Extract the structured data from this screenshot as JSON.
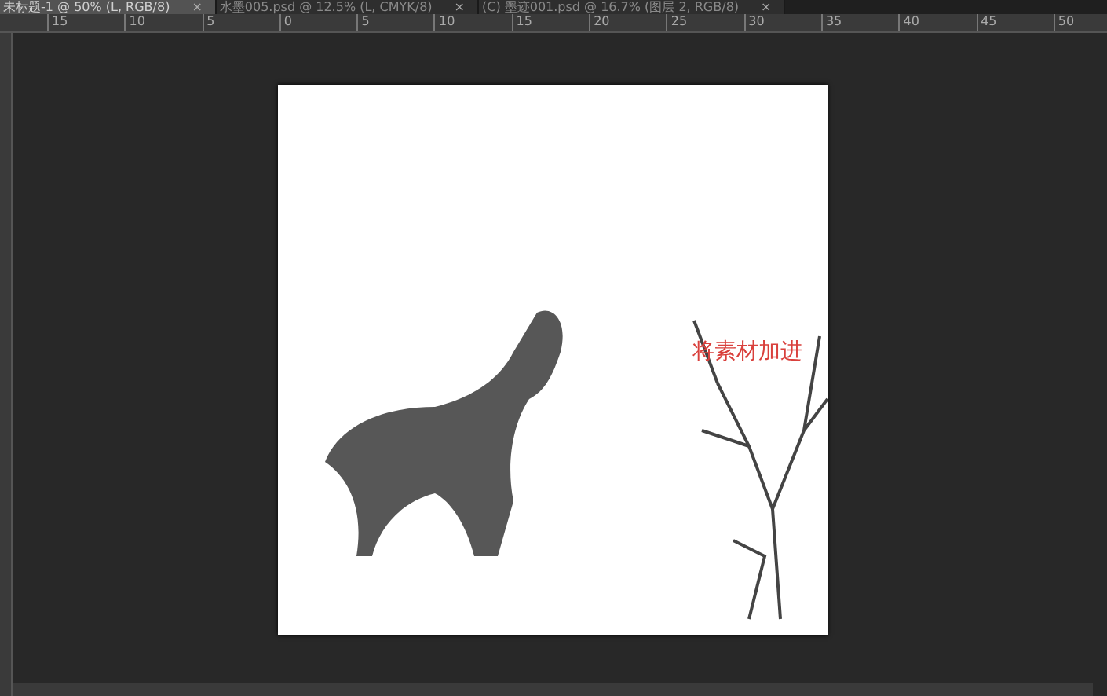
{
  "tabs": [
    {
      "label": "未标题-1 @ 50% (L, RGB/8)",
      "close": "×",
      "selected": true
    },
    {
      "label": "水墨005.psd @ 12.5% (L, CMYK/8)",
      "close": "×",
      "selected": false
    },
    {
      "label": "(C) 墨迹001.psd @ 16.7% (图层 2, RGB/8)",
      "close": "×",
      "selected": false
    }
  ],
  "ruler": {
    "labels": [
      "15",
      "10",
      "5",
      "0",
      "5",
      "10",
      "15",
      "20",
      "25",
      "30",
      "35",
      "40",
      "45",
      "50"
    ]
  },
  "canvas": {
    "caption": "将素材加进"
  }
}
